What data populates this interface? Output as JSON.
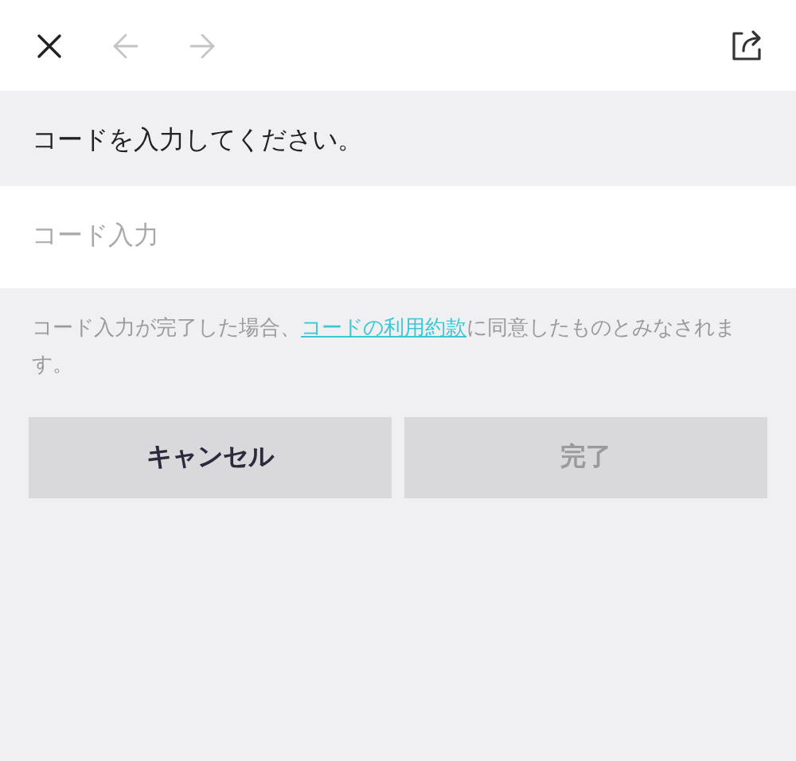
{
  "toolbar": {
    "back_disabled": true,
    "forward_disabled": true
  },
  "prompt": "コードを入力してください。",
  "code_field": {
    "placeholder": "コード入力"
  },
  "notice": {
    "before": "コード入力が完了した場合、",
    "link": "コードの利用約款",
    "after": "に同意したものとみなされます。"
  },
  "buttons": [
    {
      "label": "キャンセル",
      "disabled": false
    },
    {
      "label": "完了",
      "disabled": true
    }
  ]
}
